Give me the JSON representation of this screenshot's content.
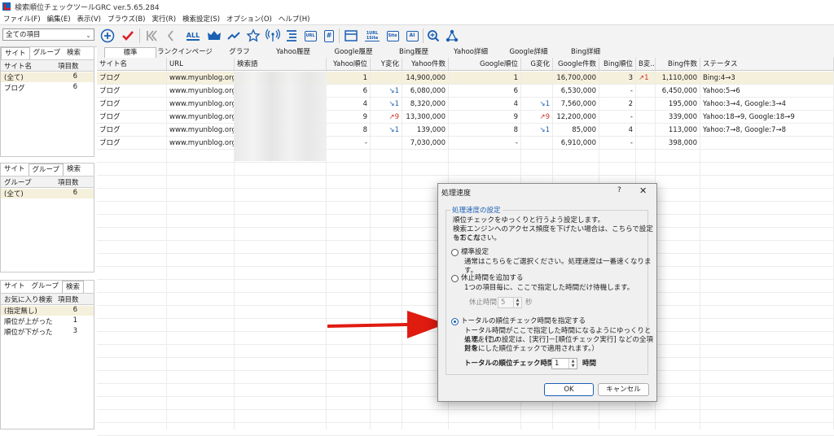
{
  "window": {
    "title": "検索順位チェックツールGRC  ver.5.65.284"
  },
  "menu": [
    "ファイル(F)",
    "編集(E)",
    "表示(V)",
    "ブラウズ(B)",
    "実行(R)",
    "検索設定(S)",
    "オプション(O)",
    "ヘルプ(H)"
  ],
  "toolbar": {
    "site_select": "全ての項目",
    "icons": [
      "add-circle-icon",
      "check-icon",
      "first-page-icon",
      "prev-page-icon",
      "all-icon",
      "crown-icon",
      "line-graph-icon",
      "star-icon",
      "antenna-icon",
      "list-icon",
      "url-icon",
      "hash-icon",
      "window-icon",
      "url-1site-icon",
      "site-icon",
      "ai-icon",
      "search-zoom-icon",
      "network-icon"
    ],
    "box_labels": {
      "url": "URL",
      "url_1site": "1URL 1Site",
      "site": "Site",
      "ai": "AI",
      "all": "ALL",
      "hash": "#"
    }
  },
  "site_panel": {
    "tabs": [
      "サイト",
      "グループ",
      "検索"
    ],
    "headers": [
      "サイト名",
      "項目数"
    ],
    "rows": [
      {
        "name": "(全て)",
        "count": "6"
      },
      {
        "name": "ブログ",
        "count": "6"
      }
    ]
  },
  "group_panel": {
    "tabs": [
      "サイト",
      "グループ",
      "検索"
    ],
    "headers": [
      "グループ",
      "項目数"
    ],
    "rows": [
      {
        "name": "(全て)",
        "count": "6"
      }
    ]
  },
  "search_panel": {
    "tabs": [
      "サイト",
      "グループ",
      "検索"
    ],
    "headers": [
      "お気に入り検索",
      "項目数"
    ],
    "rows": [
      {
        "name": "(指定無し)",
        "count": "6"
      },
      {
        "name": "順位が上がった",
        "count": "1"
      },
      {
        "name": "順位が下がった",
        "count": "3"
      }
    ]
  },
  "main_tabs": [
    "標準",
    "ランクインページ",
    "グラフ",
    "Yahoo履歴",
    "Google履歴",
    "Bing履歴",
    "Yahoo詳細",
    "Google詳細",
    "Bing詳細"
  ],
  "grid": {
    "headers": [
      "サイト名",
      "URL",
      "検索語",
      "Yahoo順位",
      "Y変化",
      "Yahoo件数",
      "Google順位",
      "G変化",
      "Google件数",
      "Bing順位",
      "B変...",
      "Bing件数",
      "ステータス"
    ],
    "rows": [
      {
        "site": "ブログ",
        "url": "www.myunblog.org",
        "kw": "",
        "y": "1",
        "yc": "",
        "ycnt": "14,900,000",
        "g": "1",
        "gc": "",
        "gcnt": "16,700,000",
        "b": "3",
        "bc": "↗1",
        "bcnt": "1,110,000",
        "status": "Bing:4→3"
      },
      {
        "site": "ブログ",
        "url": "www.myunblog.org",
        "kw": "",
        "y": "6",
        "yc": "↘1",
        "ycnt": "6,080,000",
        "g": "6",
        "gc": "",
        "gcnt": "6,530,000",
        "b": "-",
        "bc": "",
        "bcnt": "6,450,000",
        "status": "Yahoo:5→6"
      },
      {
        "site": "ブログ",
        "url": "www.myunblog.org",
        "kw": "",
        "y": "4",
        "yc": "↘1",
        "ycnt": "8,320,000",
        "g": "4",
        "gc": "↘1",
        "gcnt": "7,560,000",
        "b": "2",
        "bc": "",
        "bcnt": "195,000",
        "status": "Yahoo:3→4, Google:3→4"
      },
      {
        "site": "ブログ",
        "url": "www.myunblog.org",
        "kw": "",
        "y": "9",
        "yc": "↗9",
        "ycnt": "13,300,000",
        "g": "9",
        "gc": "↗9",
        "gcnt": "12,200,000",
        "b": "-",
        "bc": "",
        "bcnt": "339,000",
        "status": "Yahoo:18→9, Google:18→9"
      },
      {
        "site": "ブログ",
        "url": "www.myunblog.org",
        "kw": "",
        "y": "8",
        "yc": "↘1",
        "ycnt": "139,000",
        "g": "8",
        "gc": "↘1",
        "gcnt": "85,000",
        "b": "4",
        "bc": "",
        "bcnt": "113,000",
        "status": "Yahoo:7→8, Google:7→8"
      },
      {
        "site": "ブログ",
        "url": "www.myunblog.org",
        "kw": "",
        "y": "-",
        "yc": "",
        "ycnt": "7,030,000",
        "g": "-",
        "gc": "",
        "gcnt": "6,910,000",
        "b": "-",
        "bc": "",
        "bcnt": "398,000",
        "status": ""
      }
    ]
  },
  "dialog": {
    "title": "処理速度",
    "help": "?",
    "close": "✕",
    "group_label": "処理速度の設定",
    "desc1": "順位チェックをゆっくりと行うよう設定します。",
    "desc2": "検索エンジンへのアクセス頻度を下げたい場合は、こちらで設定をおこな",
    "desc3": "ってください。",
    "opt1_label": "標準設定",
    "opt1_desc": "通常はこちらをご選択ください。処理速度は一番速くなります。",
    "opt2_label": "休止時間を追加する",
    "opt2_desc": "1つの項目毎に、ここで指定した時間だけ待機します。",
    "pause_label": "休止時間",
    "pause_value": "5",
    "pause_unit": "秒",
    "opt3_label": "トータルの順位チェック時間を指定する",
    "opt3_desc1": "トータル時間がここで指定した時間になるようにゆっくりと処理を行い",
    "opt3_desc2": "ます。（この設定は、[実行]－[順位チェック実行] などの全項目を",
    "opt3_desc3": "対象にした順位チェックで適用されます。）",
    "total_label": "トータルの順位チェック時間",
    "total_value": "1",
    "total_unit": "時間",
    "ok": "OK",
    "cancel": "キャンセル",
    "selected_option": 3
  },
  "colors": {
    "accent": "#1a5fb4",
    "selected_row": "#f5f0dc",
    "arrow": "#e01b10",
    "rank_up": "#d0342c",
    "rank_down": "#1a5fb4"
  }
}
